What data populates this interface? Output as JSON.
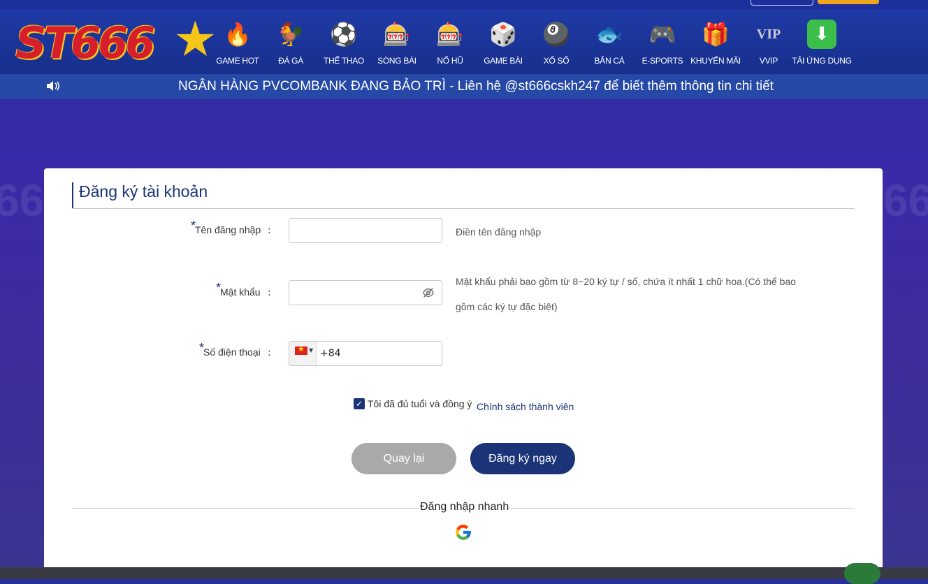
{
  "brand": {
    "logo_text": "ST666",
    "star": "★"
  },
  "nav": {
    "items": [
      {
        "label": "GAME HOT",
        "icon": "fire-icon",
        "glyph": "🔥"
      },
      {
        "label": "ĐÁ GÀ",
        "icon": "rooster-icon",
        "glyph": "🐓"
      },
      {
        "label": "THỂ THAO",
        "icon": "soccer-ball-icon",
        "glyph": "⚽"
      },
      {
        "label": "SÒNG BÀI",
        "icon": "casino-dealer-icon",
        "glyph": "🎰"
      },
      {
        "label": "NỔ HŨ",
        "icon": "slot-machine-icon",
        "glyph": "🎰"
      },
      {
        "label": "GAME BÀI",
        "icon": "dice-icon",
        "glyph": "🎲"
      },
      {
        "label": "XỔ SỐ",
        "icon": "lottery-ball-icon",
        "glyph": "🎱"
      },
      {
        "label": "BẮN CÁ",
        "icon": "fish-icon",
        "glyph": "🐟"
      },
      {
        "label": "E-SPORTS",
        "icon": "gamepad-icon",
        "glyph": "🎮"
      },
      {
        "label": "KHUYẾN MÃI",
        "icon": "gift-icon",
        "glyph": "🎁"
      },
      {
        "label": "VVIP",
        "icon": "vip-icon",
        "glyph": "VIP"
      },
      {
        "label": "TẢI ỨNG DỤNG",
        "icon": "download-icon",
        "glyph": "⬇"
      }
    ]
  },
  "marquee": {
    "text": "NGÂN HÀNG PVCOMBANK ĐANG BẢO TRÌ - Liên hệ @st666cskh247 để biết thêm thông tin chi tiết"
  },
  "form": {
    "title": "Đăng ký tài khoản",
    "username": {
      "label": "Tên đăng nhập",
      "value": "",
      "hint": "Điền tên đăng nhập"
    },
    "password": {
      "label": "Mật khẩu",
      "value": "",
      "hint_line1": "Mật khẩu phải bao gồm từ 8~20 ký tự / số, chứa ít nhất 1 chữ hoa.(Có thể bao",
      "hint_line2": "gồm các ký tự đặc biệt)"
    },
    "phone": {
      "label": "Số điện thoại",
      "country_code": "+84",
      "flag": "vietnam-flag-icon"
    },
    "required_mark": "*",
    "colon": ":",
    "agree_text": "Tôi đã đủ tuổi và đồng ý",
    "policy_link": "Chính sách thành viên",
    "agree_checked": true,
    "back_button": "Quay lại",
    "register_button": "Đăng ký ngay",
    "quick_login": "Đăng nhập nhanh"
  },
  "colors": {
    "primary": "#1b3478",
    "header": "#1f3aa6",
    "marquee": "#2648a6",
    "back_button": "#a9a9a9",
    "accent": "#f0a61c"
  }
}
